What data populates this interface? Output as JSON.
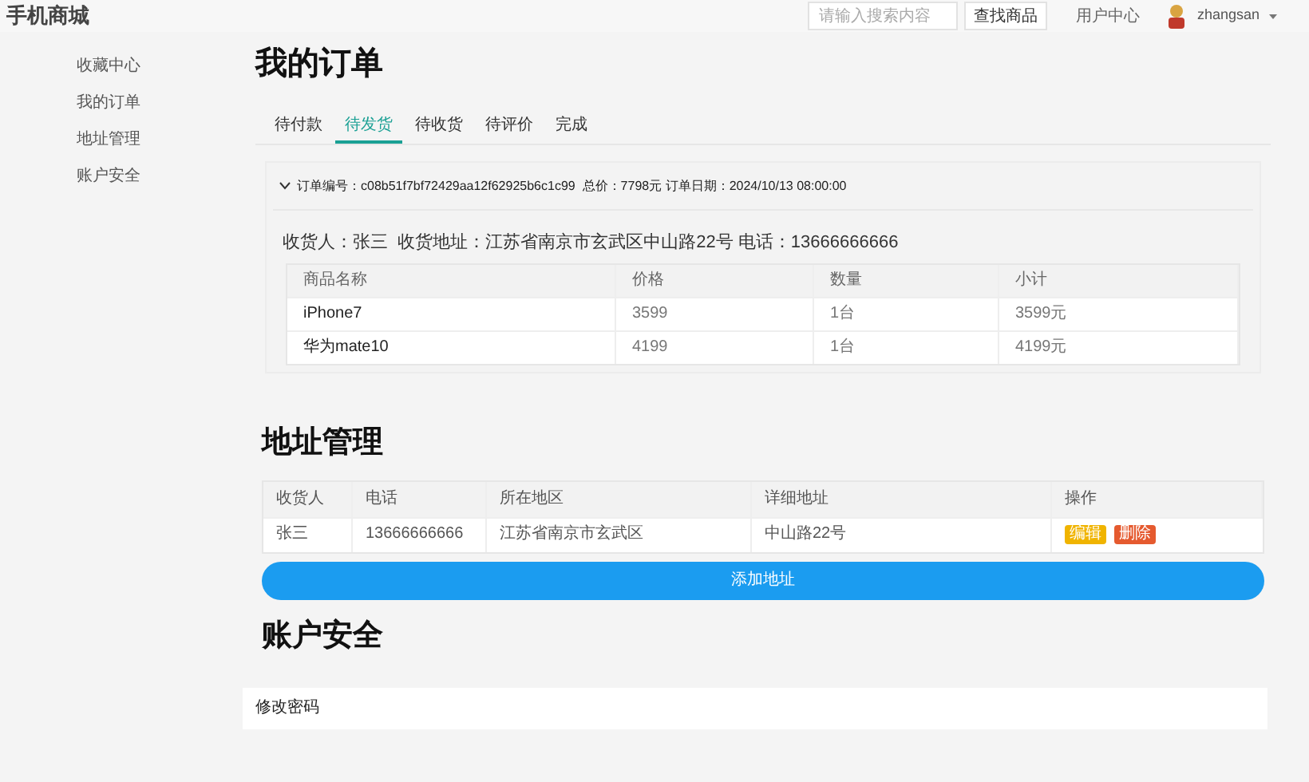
{
  "header": {
    "logo": "手机商城",
    "search": {
      "placeholder": "请输入搜索内容"
    },
    "search_button": "查找商品",
    "user_center": "用户中心",
    "username": "zhangsan"
  },
  "sidebar": {
    "items": [
      {
        "label": "收藏中心",
        "selected": false
      },
      {
        "label": "我的订单",
        "selected": false
      },
      {
        "label": "地址管理",
        "selected": false
      },
      {
        "label": "账户安全",
        "selected": false
      }
    ]
  },
  "orders": {
    "title": "我的订单",
    "tabs": [
      {
        "label": "待付款",
        "selected": false
      },
      {
        "label": "待发货",
        "selected": true
      },
      {
        "label": "待收货",
        "selected": false
      },
      {
        "label": "待评价",
        "selected": false
      },
      {
        "label": "完成",
        "selected": false
      }
    ],
    "order": {
      "expanded": true,
      "summary": "订单编号：c08b51f7bf72429aa12f62925b6c1c99  总价：7798元 订单日期：2024/10/13 08:00:00",
      "recipient": "收货人：张三  收货地址：江苏省南京市玄武区中山路22号 电话：13666666666",
      "columns": [
        "商品名称",
        "价格",
        "数量",
        "小计"
      ],
      "rows": [
        [
          "iPhone7",
          "3599",
          "1台",
          "3599元"
        ],
        [
          "华为mate10",
          "4199",
          "1台",
          "4199元"
        ]
      ]
    }
  },
  "addresses": {
    "title": "地址管理",
    "columns": [
      "收货人",
      "电话",
      "所在地区",
      "详细地址",
      "操作"
    ],
    "rows": [
      {
        "cells": [
          "张三",
          "13666666666",
          "江苏省南京市玄武区",
          "中山路22号"
        ],
        "actions": [
          {
            "label": "编辑",
            "kind": "edit"
          },
          {
            "label": "删除",
            "kind": "delete"
          }
        ]
      }
    ],
    "add_button": "添加地址"
  },
  "security": {
    "title": "账户安全",
    "items": [
      "修改密码"
    ]
  }
}
